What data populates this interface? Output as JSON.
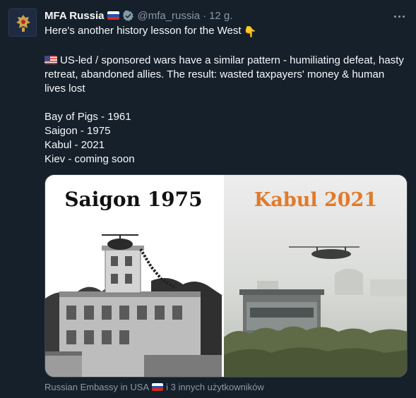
{
  "author": {
    "name": "MFA Russia",
    "handle": "@mfa_russia",
    "time": "12 g.",
    "flag_icon": "russia-flag-icon",
    "verified_icon": "verified-badge-icon"
  },
  "tweet": {
    "line1": "Here's another history lesson for the West",
    "line1_emoji": "👇",
    "paragraph2": "US-led / sponsored wars have a similar pattern - humiliating defeat, hasty retreat, abandoned allies. The result: wasted taxpayers' money & human lives lost",
    "list": [
      "Bay of Pigs - 1961",
      "Saigon - 1975",
      "Kabul - 2021",
      "Kiev - coming soon"
    ]
  },
  "media": {
    "left_caption": "Saigon 1975",
    "right_caption": "Kabul 2021",
    "colors": {
      "left_caption": "#111111",
      "right_caption": "#e07a2b"
    }
  },
  "footer": {
    "tagged_prefix": "Russian Embassy in USA",
    "tagged_suffix": "i 3 innych użytkowników"
  },
  "colors": {
    "background": "#15202b",
    "text": "#f7f9f9",
    "secondary": "#8b98a5",
    "border": "#38444d"
  }
}
